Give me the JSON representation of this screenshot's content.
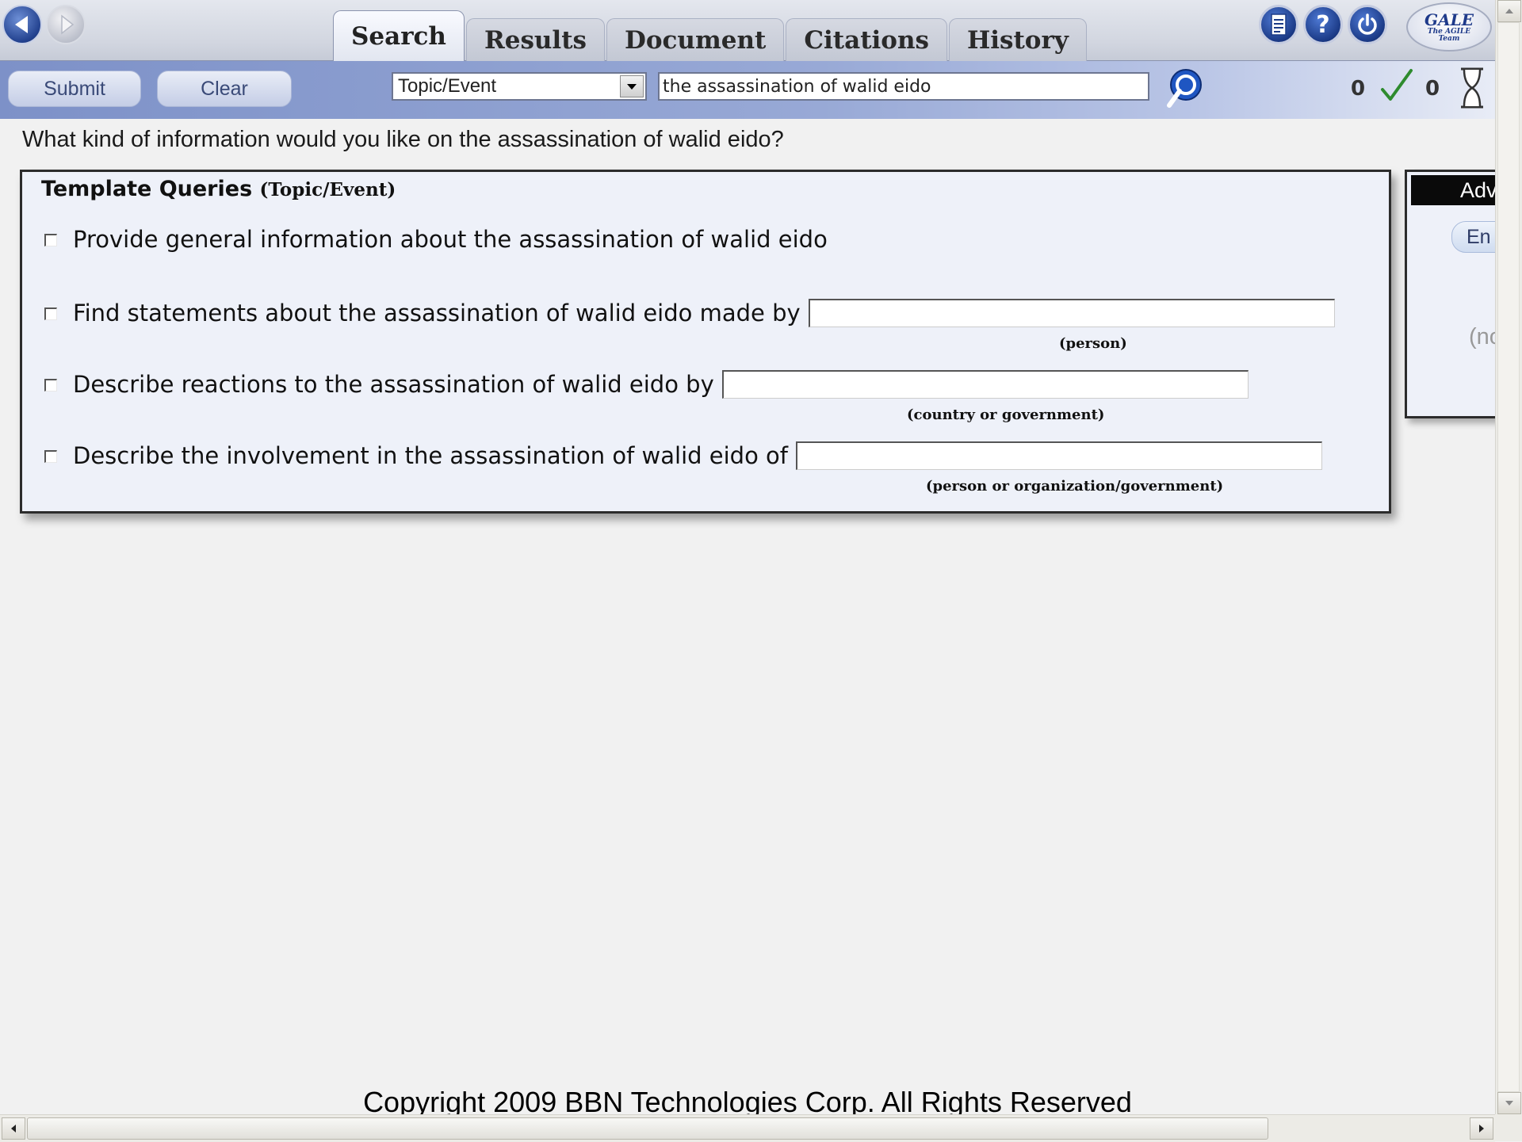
{
  "header": {
    "tabs": [
      {
        "label": "Search",
        "active": true
      },
      {
        "label": "Results",
        "active": false
      },
      {
        "label": "Document",
        "active": false
      },
      {
        "label": "Citations",
        "active": false
      },
      {
        "label": "History",
        "active": false
      }
    ],
    "icons": [
      "back-arrow-icon",
      "forward-arrow-icon",
      "document-icon",
      "help-icon",
      "power-icon"
    ],
    "logo": {
      "line1": "GALE",
      "line2": "The AGILE",
      "line3": "Team"
    }
  },
  "toolbar": {
    "submit_label": "Submit",
    "clear_label": "Clear",
    "query_type": "Topic/Event",
    "query_text": "the assassination of walid eido",
    "count_left": "0",
    "count_right": "0"
  },
  "main": {
    "prompt": "What kind of information would you like on the assassination of walid eido?",
    "panel_title": "Template Queries",
    "panel_subtitle": "(Topic/Event)",
    "queries": [
      {
        "text": "Provide general information about the assassination of walid eido",
        "hint": ""
      },
      {
        "text": "Find statements about the assassination of walid eido made by",
        "hint": "(person)"
      },
      {
        "text": "Describe reactions to the assassination of walid eido by",
        "hint": "(country or government)"
      },
      {
        "text": "Describe the involvement in the assassination of walid eido of",
        "hint": "(person or organization/government)"
      }
    ]
  },
  "side_panel": {
    "header": "Adv",
    "pill": "En",
    "note": "(no"
  },
  "footer": {
    "copyright": "Copyright 2009 BBN Technologies Corp. All Rights Reserved"
  },
  "colors": {
    "toolbar_blue": "#7d91c8",
    "panel_bg": "#eef1f9",
    "accent_blue": "#1b3a86",
    "check_green": "#2e8b2e"
  }
}
